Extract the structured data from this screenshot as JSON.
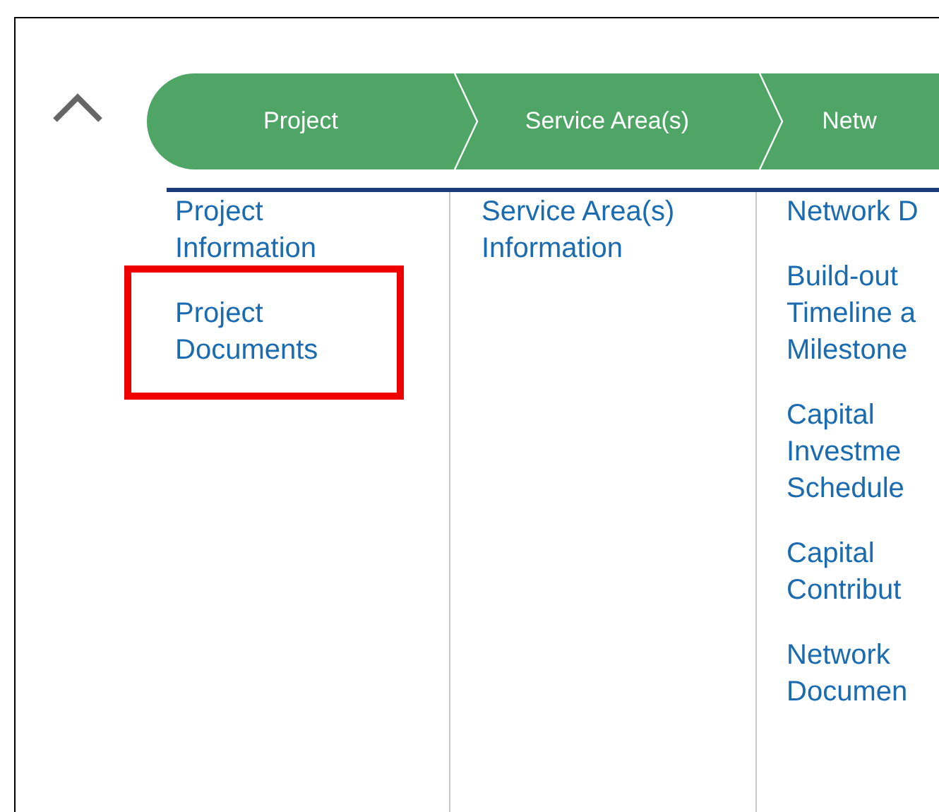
{
  "collapse_button": {
    "expanded": true
  },
  "steps": [
    {
      "label": "Project"
    },
    {
      "label": "Service Area(s)"
    },
    {
      "label": "Netw"
    }
  ],
  "columns": [
    {
      "items": [
        {
          "lines": [
            "Project",
            "Information"
          ],
          "highlighted": false
        },
        {
          "lines": [
            "Project",
            "Documents"
          ],
          "highlighted": true
        }
      ]
    },
    {
      "items": [
        {
          "lines": [
            "Service Area(s)",
            "Information"
          ],
          "highlighted": false
        }
      ]
    },
    {
      "items": [
        {
          "lines": [
            "Network D"
          ],
          "highlighted": false
        },
        {
          "lines": [
            "Build-out",
            "Timeline a",
            "Milestone"
          ],
          "highlighted": false
        },
        {
          "lines": [
            "Capital",
            "Investme",
            "Schedule"
          ],
          "highlighted": false
        },
        {
          "lines": [
            "Capital",
            "Contribut"
          ],
          "highlighted": false
        },
        {
          "lines": [
            "Network",
            "Documen"
          ],
          "highlighted": false
        }
      ]
    }
  ]
}
